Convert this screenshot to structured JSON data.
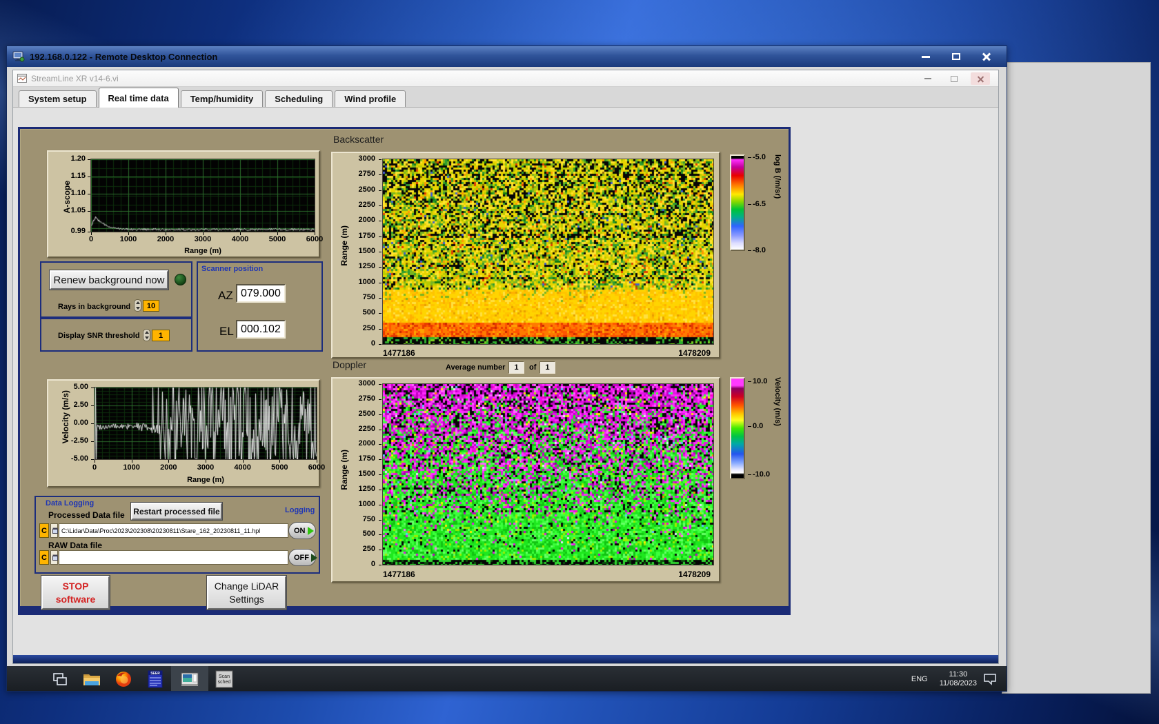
{
  "rdp": {
    "title": "192.168.0.122 - Remote Desktop Connection"
  },
  "app": {
    "title": "StreamLine XR v14-6.vi",
    "tabs": [
      {
        "label": "System setup",
        "active": false
      },
      {
        "label": "Real time data",
        "active": true
      },
      {
        "label": "Temp/humidity",
        "active": false
      },
      {
        "label": "Scheduling",
        "active": false
      },
      {
        "label": "Wind profile",
        "active": false
      }
    ]
  },
  "panel": {
    "ascope": {
      "ylabel": "A-scope",
      "xlabel": "Range (m)"
    },
    "renew": {
      "button": "Renew background now",
      "rays_label": "Rays in background",
      "rays_value": "10"
    },
    "snr": {
      "label": "Display SNR threshold",
      "value": "1"
    },
    "scanner": {
      "title": "Scanner position",
      "az_label": "AZ",
      "az_value": "079.000",
      "el_label": "EL",
      "el_value": "000.102"
    },
    "backscatter": {
      "title": "Backscatter",
      "ylabel": "Range (m)",
      "x_start": "1477186",
      "x_end": "1478209",
      "cbar_labels": [
        "-5.0",
        "-6.5",
        "-8.0"
      ],
      "cbar_title": "log B (/m/sr)"
    },
    "doppler": {
      "title": "Doppler",
      "avg_label": "Average number",
      "avg_value": "1",
      "of": "of",
      "avg_total": "1",
      "ylabel": "Range (m)",
      "x_start": "1477186",
      "x_end": "1478209",
      "cbar_labels": [
        "10.0",
        "0.0",
        "-10.0"
      ],
      "cbar_title": "Velocity (m/s)"
    },
    "velocity": {
      "ylabel": "Velocity (m/s)",
      "xlabel": "Range (m)"
    },
    "logging": {
      "title": "Data Logging",
      "processed_label": "Processed Data file",
      "restart_button": "Restart processed file",
      "logging_label": "Logging",
      "drive": "C",
      "processed_path": "C:\\Lidar\\Data\\Proc\\2023\\202308\\20230811\\Stare_162_20230811_11.hpl",
      "on": "ON",
      "raw_label": "RAW Data file",
      "raw_path": "",
      "off": "OFF"
    },
    "stop_button": {
      "line1": "STOP",
      "line2": "software"
    },
    "change_button": {
      "line1": "Change LiDAR",
      "line2": "Settings"
    }
  },
  "taskbar": {
    "lang": "ENG",
    "time": "11:30",
    "date": "11/08/2023",
    "scan_line1": "Scan",
    "scan_line2": "sched"
  },
  "chart_data": [
    {
      "id": "ascope",
      "type": "line",
      "title": "A-scope",
      "xlabel": "Range (m)",
      "ylabel": "A-scope",
      "xlim": [
        0,
        6000
      ],
      "ylim": [
        0.99,
        1.2
      ],
      "xticks": [
        0,
        1000,
        2000,
        3000,
        4000,
        5000,
        6000
      ],
      "yticks": [
        "1.20",
        "1.15",
        "1.10",
        "1.05",
        "0.99"
      ],
      "grid": true,
      "series": [
        {
          "name": "a-scope",
          "summary": "Noisy flat trace near 1.00 across full range; initial peak of about 1.035 near 150 m decaying to baseline by about 1000 m."
        }
      ]
    },
    {
      "id": "velocity",
      "type": "line",
      "title": "Velocity",
      "xlabel": "Range (m)",
      "ylabel": "Velocity (m/s)",
      "xlim": [
        0,
        6000
      ],
      "ylim": [
        -5,
        5
      ],
      "xticks": [
        0,
        1000,
        2000,
        3000,
        4000,
        5000,
        6000
      ],
      "yticks": [
        "5.00",
        "2.50",
        "0.00",
        "-2.50",
        "-5.00"
      ],
      "grid": true,
      "series": [
        {
          "name": "velocity",
          "summary": "About -0.5 m/s with small noise out to about 1600 m, then saturated random spikes spanning ±5 m/s (noise) to 6000 m."
        }
      ]
    },
    {
      "id": "backscatter",
      "type": "heatmap",
      "title": "Backscatter",
      "ylabel": "Range (m)",
      "ylim": [
        0,
        3000
      ],
      "yticks": [
        3000,
        2750,
        2500,
        2250,
        2000,
        1750,
        1500,
        1250,
        1000,
        750,
        500,
        250,
        0
      ],
      "x_range": [
        "1477186",
        "1478209"
      ],
      "colorbar": {
        "title": "log B (/m/sr)",
        "ticks": [
          "-5.0",
          "-6.5",
          "-8.0"
        ],
        "range": [
          -8.0,
          -5.0
        ]
      },
      "summary": "Strong uniform yellow/orange backscatter below ~700 m with a red band near 150-250 m and black at 0 m; speckled yellow-green-black noise above ~1500 m, constant over the whole time window."
    },
    {
      "id": "doppler",
      "type": "heatmap",
      "title": "Doppler",
      "ylabel": "Range (m)",
      "ylim": [
        0,
        3000
      ],
      "yticks": [
        3000,
        2750,
        2500,
        2250,
        2000,
        1750,
        1500,
        1250,
        1000,
        750,
        500,
        250,
        0
      ],
      "x_range": [
        "1477186",
        "1478209"
      ],
      "colorbar": {
        "title": "Velocity (m/s)",
        "ticks": [
          "10.0",
          "0.0",
          "-10.0"
        ],
        "range": [
          -10.0,
          10.0
        ]
      },
      "summary": "Bright green (velocity near 0 m/s) below ~1200 m transitioning to random magenta/black noise above ~1800 m, constant over the whole time window."
    }
  ]
}
